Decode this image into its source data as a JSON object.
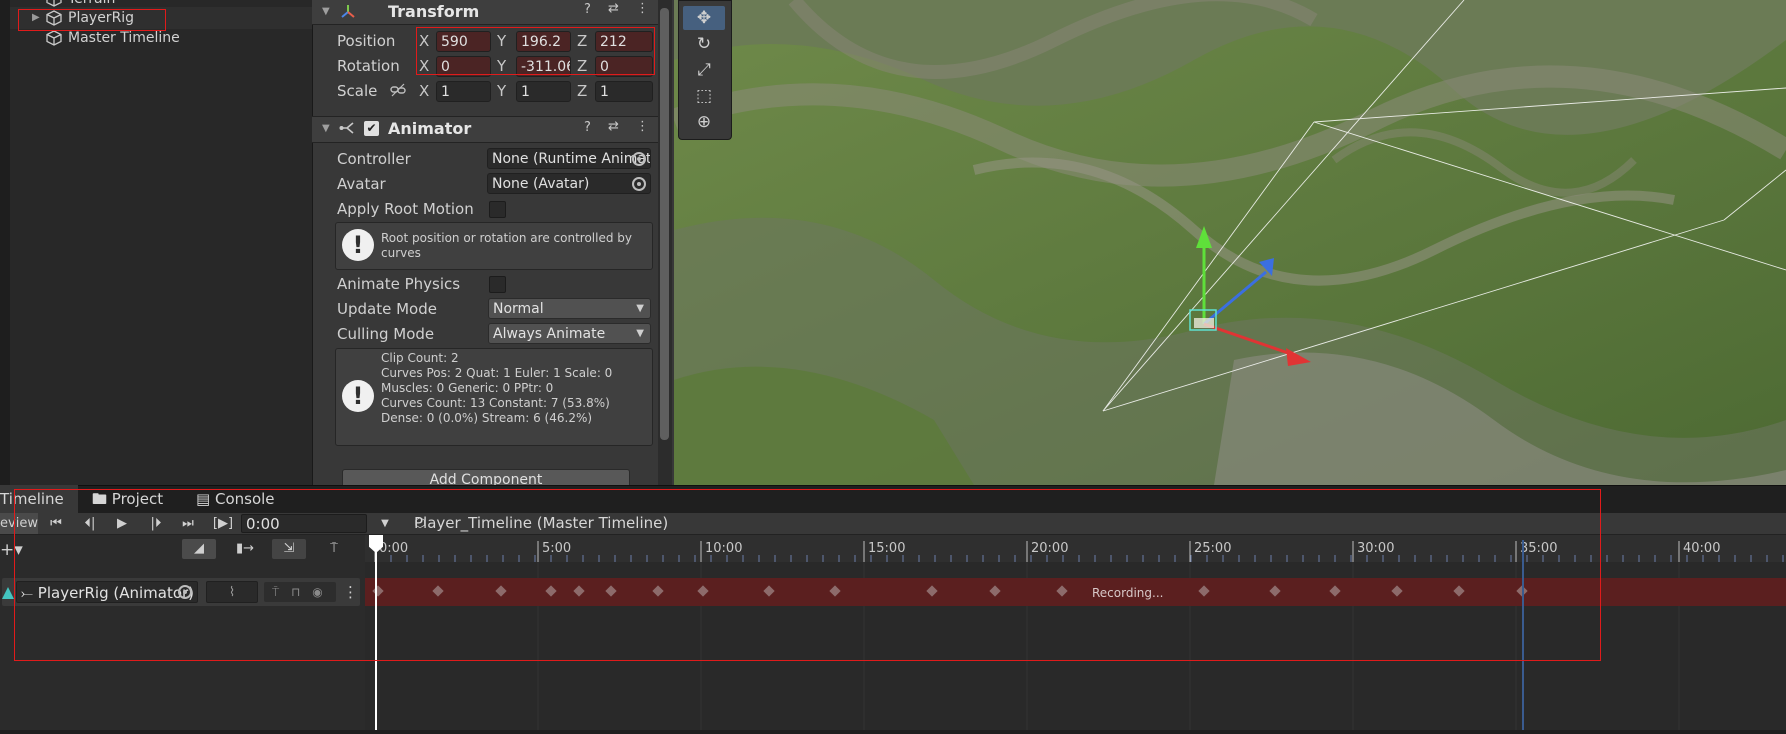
{
  "hierarchy": {
    "items": [
      {
        "label": "Terrain"
      },
      {
        "label": "PlayerRig"
      },
      {
        "label": "Master Timeline"
      }
    ]
  },
  "inspector": {
    "transform": {
      "title": "Transform",
      "position": {
        "label": "Position",
        "x": "590",
        "y": "196.2",
        "z": "212"
      },
      "rotation": {
        "label": "Rotation",
        "x": "0",
        "y": "-311.06",
        "z": "0"
      },
      "scale": {
        "label": "Scale",
        "x": "1",
        "y": "1",
        "z": "1"
      },
      "axis_x": "X",
      "axis_y": "Y",
      "axis_z": "Z"
    },
    "animator": {
      "title": "Animator",
      "controller_label": "Controller",
      "controller_value": "None (Runtime Animator Controller)",
      "avatar_label": "Avatar",
      "avatar_value": "None (Avatar)",
      "apply_root_motion_label": "Apply Root Motion",
      "root_help": "Root position or rotation are controlled by curves",
      "animate_physics_label": "Animate Physics",
      "update_mode_label": "Update Mode",
      "update_mode_value": "Normal",
      "culling_mode_label": "Culling Mode",
      "culling_mode_value": "Always Animate",
      "stats": [
        "Clip Count: 2",
        "Curves Pos: 2 Quat: 1 Euler: 1 Scale: 0",
        "Muscles: 0 Generic: 0 PPtr: 0",
        "Curves Count: 13 Constant: 7 (53.8%)",
        "Dense: 0 (0.0%) Stream: 6 (46.2%)"
      ]
    },
    "add_component": "Add Component"
  },
  "tabs": {
    "timeline": "Timeline",
    "project": "Project",
    "console": "Console"
  },
  "timeline": {
    "preview": "eview",
    "time_value": "0:00",
    "breadcrumb": "Player_Timeline (Master Timeline)",
    "ruler": [
      "0:00",
      "5:00",
      "10:00",
      "15:00",
      "20:00",
      "25:00",
      "30:00",
      "35:00",
      "40:00"
    ],
    "track_name": "PlayerRig (Animator)",
    "recording": "Recording..."
  },
  "colors": {
    "highlight_box": "#e01b1b",
    "record_track": "#5b1f1f",
    "panel": "#383838"
  }
}
